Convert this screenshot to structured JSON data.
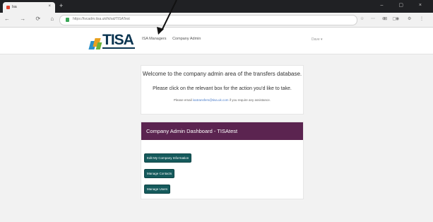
{
  "browser": {
    "tab_title": "Isa",
    "tab_close": "×",
    "new_tab": "+",
    "window_controls": "– ▢ ×",
    "nav_buttons": "← → ⟳ ⌂",
    "url": "https://tvcadm.tisa.uk/ht/ad/TISATest",
    "url_icons": "☆ ⋯ ⊕ ▢",
    "ext_icons": "⊞ ◉ ⚙ ⋮"
  },
  "site": {
    "logo_text": "TISA",
    "nav": [
      "ISA Managers",
      "Company Admin"
    ],
    "user_menu": "Dave ▾",
    "welcome": {
      "heading": "Welcome to the company admin area of the transfers database.",
      "instruction": "Please click on the relevant box for the action you'd like to take.",
      "contact_prefix": "Please email ",
      "contact_link": "isatransfers@tisa.uk.com",
      "contact_suffix": " if you require any assistance."
    },
    "dashboard": {
      "title": "Company Admin Dashboard - TISAtest",
      "buttons": [
        "Edit My Company Information",
        "Manage Contacts",
        "Manage Users"
      ]
    }
  },
  "colors": {
    "dashboard_header": "#5b2450",
    "button": "#155a5c",
    "logo_text": "#0a3450"
  },
  "icons": [
    "tab-favicon-icon",
    "lock-icon",
    "annotation-arrow-icon",
    "tisa-logo-icon"
  ]
}
